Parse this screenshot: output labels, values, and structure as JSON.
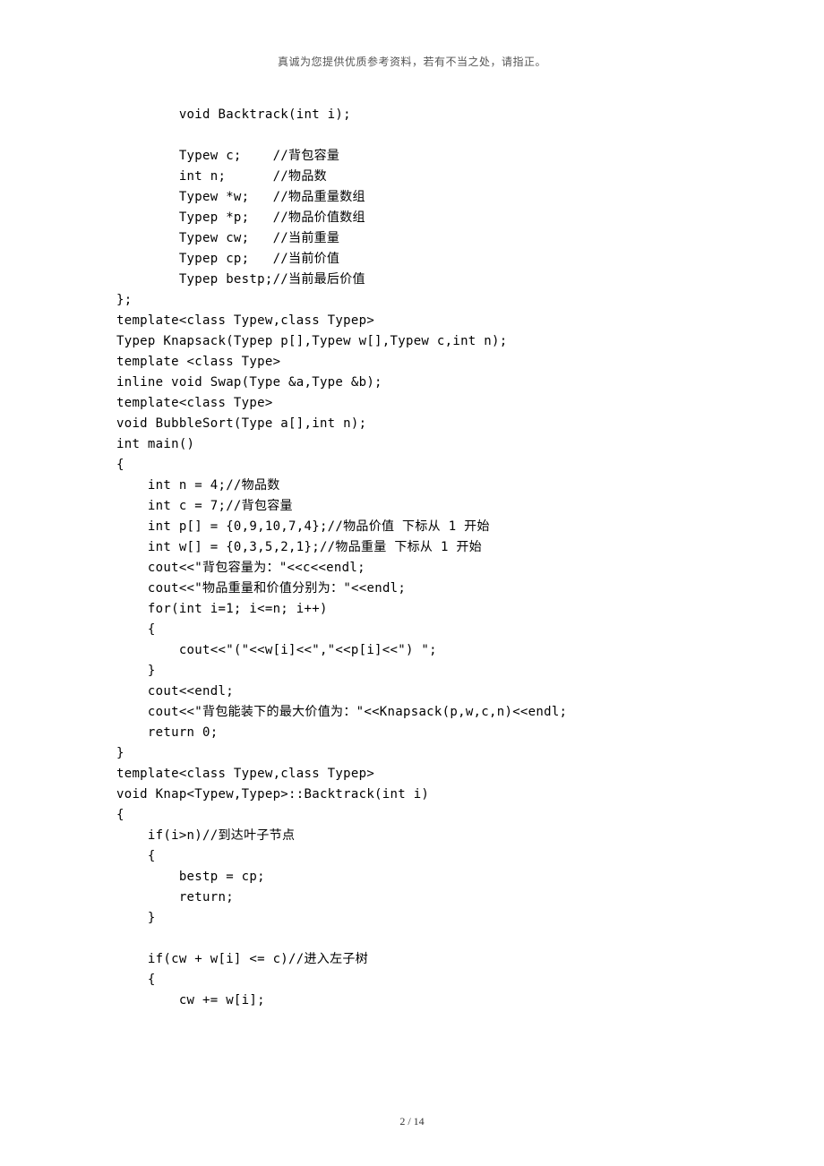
{
  "header": "真诚为您提供优质参考资料，若有不当之处，请指正。",
  "footer": "2 / 14",
  "code_lines": [
    "        void Backtrack(int i);",
    "",
    "        Typew c;    //背包容量",
    "        int n;      //物品数",
    "        Typew *w;   //物品重量数组",
    "        Typep *p;   //物品价值数组",
    "        Typew cw;   //当前重量",
    "        Typep cp;   //当前价值",
    "        Typep bestp;//当前最后价值",
    "};",
    "template<class Typew,class Typep>",
    "Typep Knapsack(Typep p[],Typew w[],Typew c,int n);",
    "template <class Type>",
    "inline void Swap(Type &a,Type &b);",
    "template<class Type>",
    "void BubbleSort(Type a[],int n);",
    "int main()",
    "{",
    "    int n = 4;//物品数",
    "    int c = 7;//背包容量",
    "    int p[] = {0,9,10,7,4};//物品价值 下标从 1 开始",
    "    int w[] = {0,3,5,2,1};//物品重量 下标从 1 开始",
    "    cout<<\"背包容量为：\"<<c<<endl;",
    "    cout<<\"物品重量和价值分别为：\"<<endl;",
    "    for(int i=1; i<=n; i++)",
    "    {",
    "        cout<<\"(\"<<w[i]<<\",\"<<p[i]<<\") \";",
    "    }",
    "    cout<<endl;",
    "    cout<<\"背包能装下的最大价值为：\"<<Knapsack(p,w,c,n)<<endl;",
    "    return 0;",
    "}",
    "template<class Typew,class Typep>",
    "void Knap<Typew,Typep>::Backtrack(int i)",
    "{",
    "    if(i>n)//到达叶子节点",
    "    {",
    "        bestp = cp;",
    "        return;",
    "    }",
    "",
    "    if(cw + w[i] <= c)//进入左子树",
    "    {",
    "        cw += w[i];"
  ]
}
